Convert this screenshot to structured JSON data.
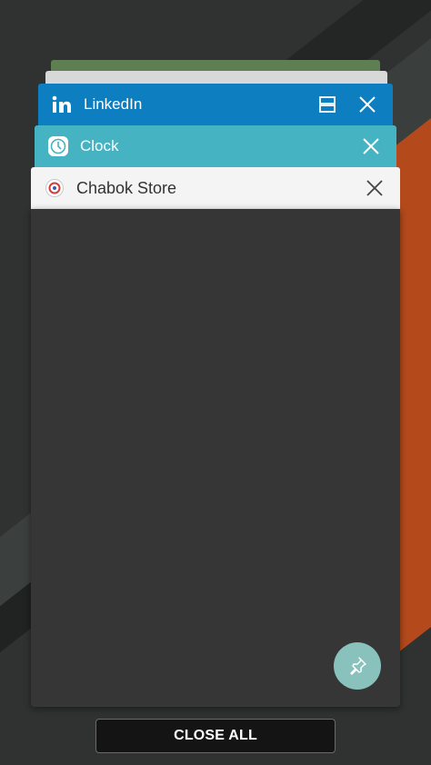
{
  "recents": {
    "cards": [
      {
        "app": "LinkedIn",
        "icon": "linkedin-icon",
        "color": "#0d7fc0",
        "actions": [
          "split-screen-icon",
          "close-icon"
        ]
      },
      {
        "app": "Clock",
        "icon": "clock-icon",
        "color": "#45b3c2",
        "actions": [
          "close-icon"
        ]
      },
      {
        "app": "Chabok Store",
        "icon": "chabok-store-icon",
        "color": "#f4f4f4",
        "actions": [
          "close-icon"
        ]
      }
    ],
    "pin_icon": "pin-icon",
    "close_all_label": "CLOSE ALL"
  },
  "colors": {
    "accent_orange": "#b44a1c",
    "pin_button": "#89c2bd",
    "preview_bg": "#363636"
  }
}
